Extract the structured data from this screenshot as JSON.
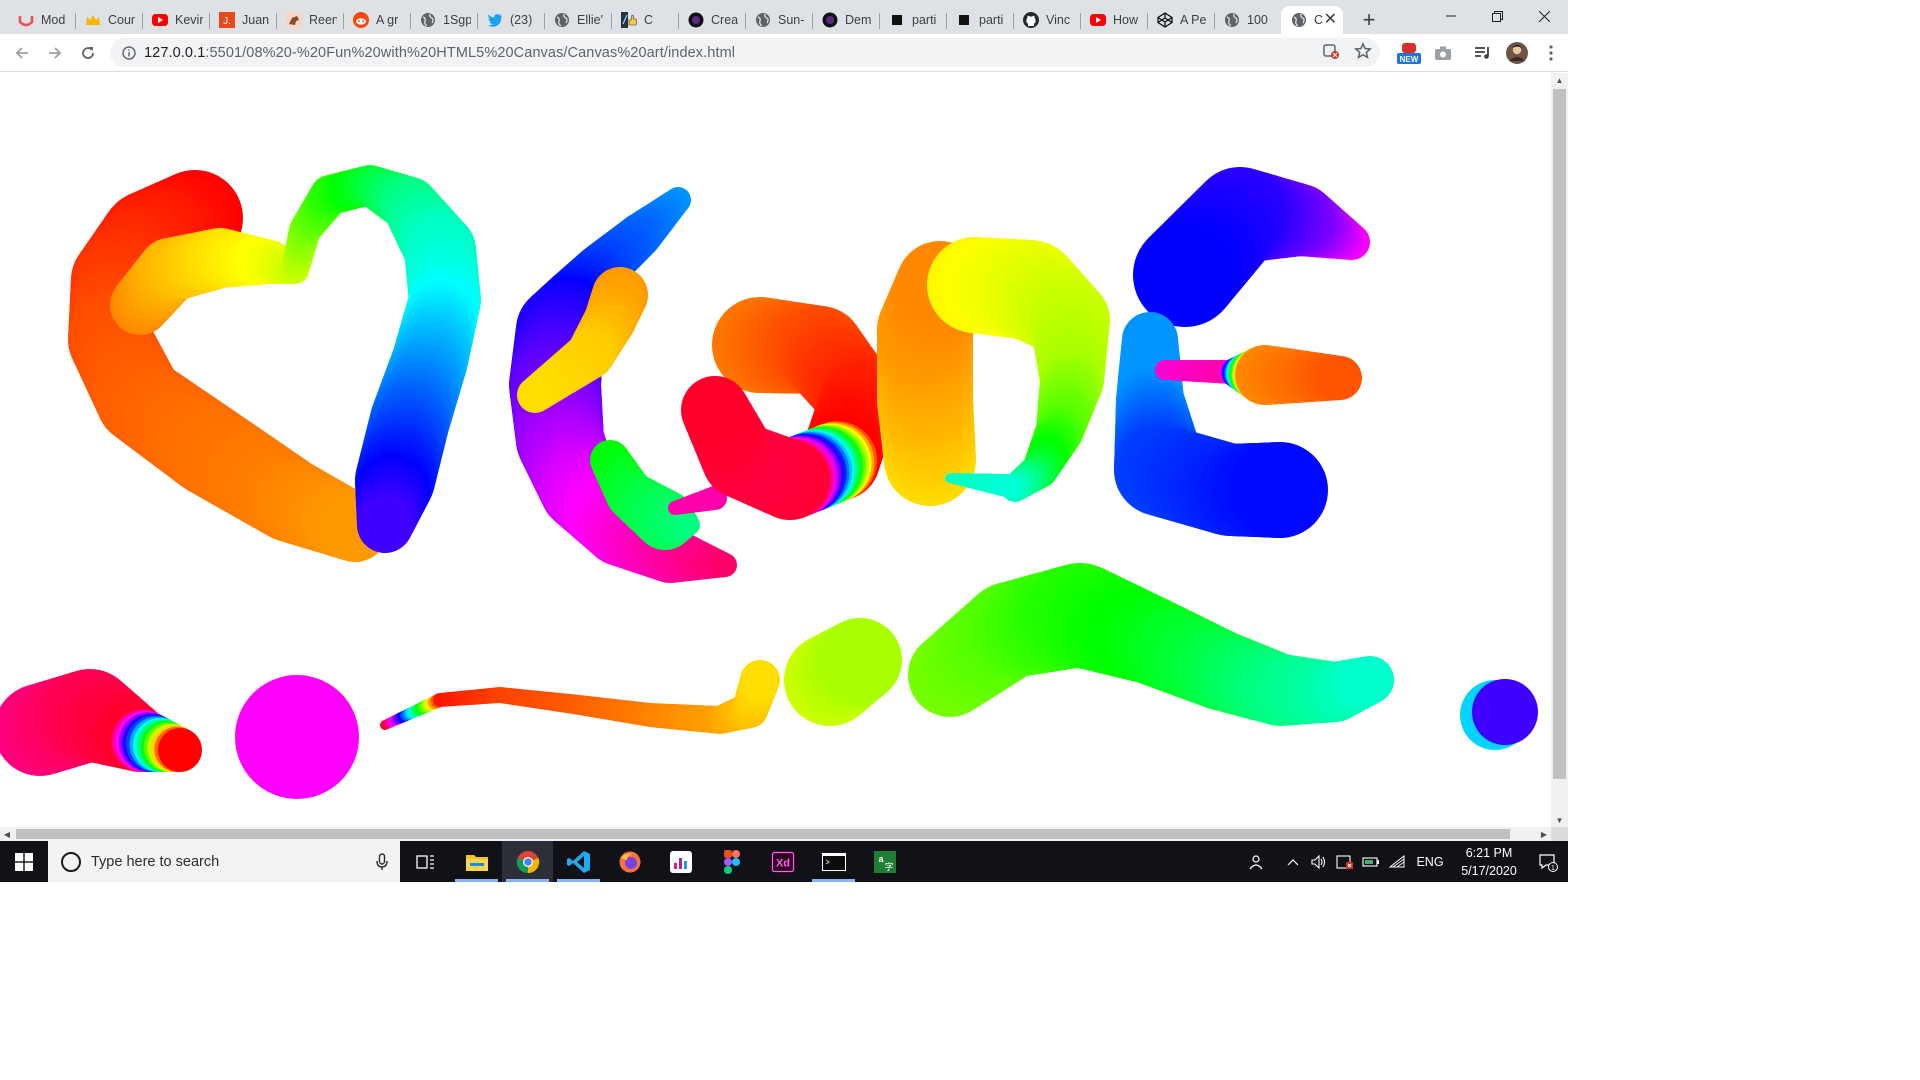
{
  "tabs": [
    {
      "title": "Mod",
      "icon": "udemy-icon"
    },
    {
      "title": "Cour",
      "icon": "crown-icon"
    },
    {
      "title": "Kevir",
      "icon": "youtube-icon"
    },
    {
      "title": "Juan",
      "icon": "j-letter-icon"
    },
    {
      "title": "Reen",
      "icon": "horse-icon"
    },
    {
      "title": "A gr",
      "icon": "reddit-icon"
    },
    {
      "title": "1Sgp",
      "icon": "globe-icon"
    },
    {
      "title": "(23)",
      "icon": "twitter-icon"
    },
    {
      "title": "Ellie'",
      "icon": "globe-icon"
    },
    {
      "title": "C",
      "icon": "thumbs-up-icon"
    },
    {
      "title": "Crea",
      "icon": "dark-circle-icon"
    },
    {
      "title": "Sun-",
      "icon": "globe-icon"
    },
    {
      "title": "Dem",
      "icon": "dark-circle-icon"
    },
    {
      "title": "parti",
      "icon": "black-square-icon"
    },
    {
      "title": "parti",
      "icon": "black-square-icon"
    },
    {
      "title": "Vinc",
      "icon": "github-icon"
    },
    {
      "title": "How",
      "icon": "youtube-icon"
    },
    {
      "title": "A Pe",
      "icon": "codepen-icon"
    },
    {
      "title": "100",
      "icon": "globe-icon"
    },
    {
      "title": "C",
      "icon": "globe-icon",
      "active": true
    }
  ],
  "address": {
    "host": "127.0.0.1",
    "path": ":5501/08%20-%20Fun%20with%20HTML5%20Canvas/Canvas%20art/index.html"
  },
  "toolbar": {
    "new_badge": "NEW"
  },
  "taskbar": {
    "search_placeholder": "Type here to search",
    "language": "ENG",
    "time": "6:21 PM",
    "date": "5/17/2020",
    "notification_count": "1"
  },
  "canvas": {
    "description_icon": "canvas-drawing"
  }
}
